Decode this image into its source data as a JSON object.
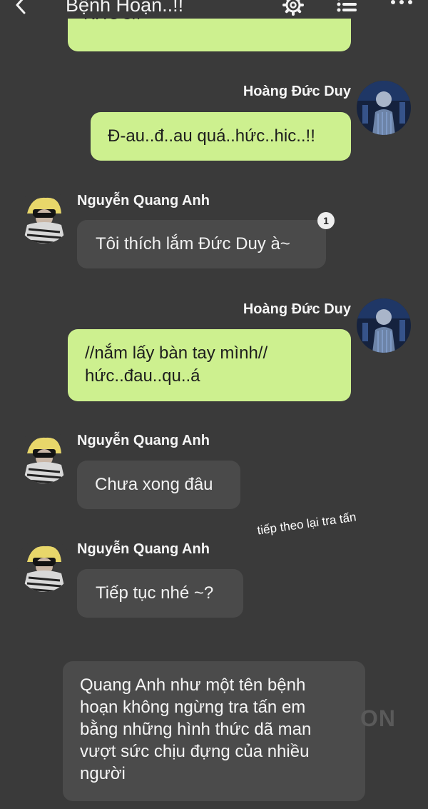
{
  "header": {
    "title": "Bệnh Hoạn..!!",
    "back_icon": "chevron-left-icon",
    "settings_icon": "gear-icon",
    "menu_icon": "list-icon",
    "more_icon": "more-dots-icon"
  },
  "partial_message": {
    "text": "KHOC//"
  },
  "messages": [
    {
      "sender": "Hoàng Đức Duy",
      "text": "Đ-au..đ..au quá..hức..hic..!!"
    },
    {
      "sender": "Nguyễn Quang Anh",
      "text": "Tôi thích lắm Đức Duy à~",
      "reaction_count": "1"
    },
    {
      "sender": "Hoàng Đức Duy",
      "text": "//nắm lấy bàn tay mình//\nhức..đau..qu..á"
    },
    {
      "sender": "Nguyễn Quang Anh",
      "text": "Chưa xong đâu"
    },
    {
      "sender": "Nguyễn Quang Anh",
      "text": "Tiếp tục nhé ~?"
    }
  ],
  "annotation": "tiếp theo lại tra tấn",
  "narration": "Quang Anh như một tên bệnh hoạn không ngừng tra tấn em bằng những hình thức dã man vượt sức chịu đựng của nhiều người",
  "watermark": "ON",
  "colors": {
    "background": "#3a3a3a",
    "outgoing_bubble": "#cdf08f",
    "incoming_bubble": "#4a4a4a",
    "text_light": "#f2f2f2"
  }
}
